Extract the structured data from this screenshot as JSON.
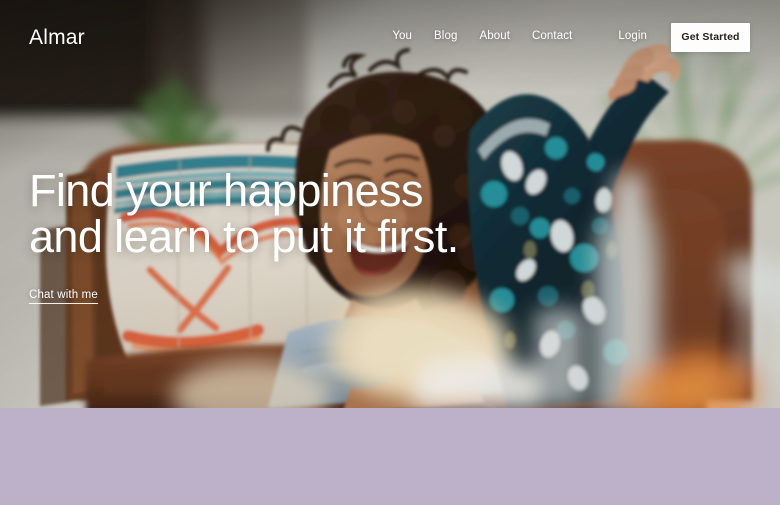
{
  "site": {
    "brand": "Almar",
    "accent_purple": "#bcb1c8",
    "nav_text_color": "#ffffff",
    "cta_bg": "#fdfdfd",
    "cta_text_color": "#25201d"
  },
  "nav": {
    "links": [
      {
        "label": "You"
      },
      {
        "label": "Blog"
      },
      {
        "label": "About"
      },
      {
        "label": "Contact"
      },
      {
        "label": "Login"
      }
    ],
    "cta_label": "Get Started"
  },
  "hero": {
    "headline_line1": "Find your happiness",
    "headline_line2": "and learn to put it first.",
    "chat_link_label": "Chat with me",
    "image_alt": "Woman with curly dark hair laughing on a brown leather couch with striped tie-dye pillow and houseplant"
  },
  "lower_band": {
    "background": "#bcb1c8",
    "content": ""
  }
}
